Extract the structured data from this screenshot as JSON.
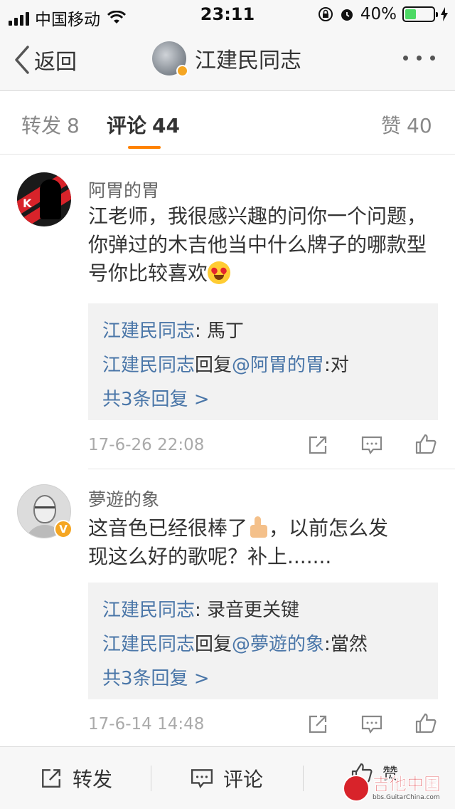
{
  "status_bar": {
    "carrier": "中国移动",
    "time": "23:11",
    "battery_percent": "40%",
    "battery_level": 0.4,
    "battery_color": "#4cd964"
  },
  "nav": {
    "back_label": "返回",
    "title": "江建民同志",
    "more_icon": "more-dots-icon"
  },
  "tabs": [
    {
      "label": "转发",
      "count": "8"
    },
    {
      "label": "评论",
      "count": "44"
    },
    {
      "label": "赞",
      "count": "40"
    }
  ],
  "accent_color": "#ff8200",
  "link_color": "#4a76a8",
  "comments": [
    {
      "name": "阿胃的胃",
      "text": "江老师，我很感兴趣的问你一个问题，你弹过的木吉他当中什么牌子的哪款型号你比较喜欢",
      "emoji": "heart-eyes-emoji",
      "replies": [
        {
          "author": "江建民同志",
          "sep": ": ",
          "text": "馬丁"
        },
        {
          "author": "江建民同志",
          "mid": "回复",
          "mention": "@阿胃的胃",
          "sep": ":",
          "text": "对"
        }
      ],
      "more_replies": "共3条回复 >",
      "time": "17-6-26 22:08"
    },
    {
      "name": "夢遊的象",
      "text_a": "这音色已经很棒了",
      "emoji": "thumbs-up-emoji",
      "text_b": "，以前怎么发",
      "text_c": "现这么好的歌呢？补上.......",
      "verified": "V",
      "replies": [
        {
          "author": "江建民同志",
          "sep": ": ",
          "text": "录音更关键"
        },
        {
          "author": "江建民同志",
          "mid": "回复",
          "mention": "@夢遊的象",
          "sep": ":",
          "text": "當然"
        }
      ],
      "more_replies": "共3条回复 >",
      "time": "17-6-14 14:48"
    }
  ],
  "bottom_bar": {
    "repost_label": "转发",
    "comment_label": "评论",
    "like_label": "赞"
  },
  "watermark": {
    "name": "吉他中国",
    "url": "bbs.GuitarChina.com"
  }
}
